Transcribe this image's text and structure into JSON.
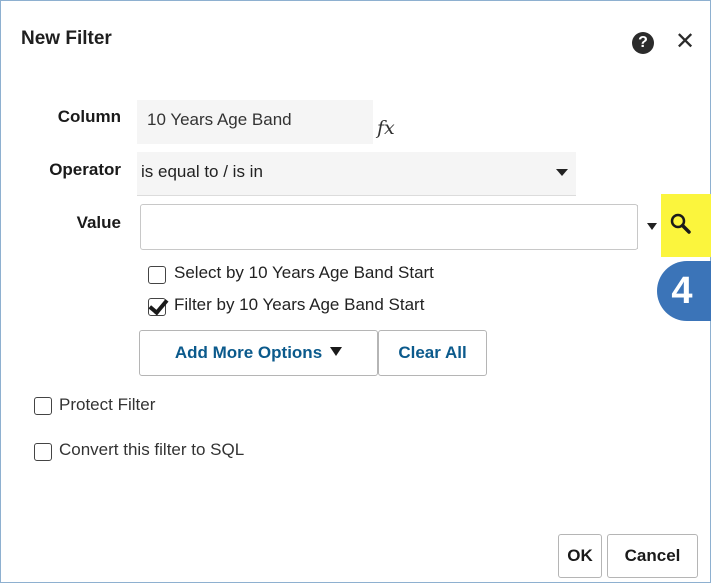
{
  "dialog": {
    "title": "New Filter",
    "help_icon_text": "?",
    "close_icon_text": "✕"
  },
  "form": {
    "column_label": "Column",
    "column_value": "10 Years Age Band",
    "fx_icon_text": "fx",
    "operator_label": "Operator",
    "operator_value": "is equal to / is in",
    "value_label": "Value",
    "value_input": ""
  },
  "options": {
    "select_by_label": "Select by 10 Years Age Band Start",
    "select_by_checked": false,
    "filter_by_label": "Filter by 10 Years Age Band Start",
    "filter_by_checked": true,
    "add_more_label": "Add More Options",
    "clear_all_label": "Clear All"
  },
  "extra": {
    "protect_filter_label": "Protect Filter",
    "protect_filter_checked": false,
    "convert_sql_label": "Convert this filter to SQL",
    "convert_sql_checked": false
  },
  "annotation": {
    "step_number": "4",
    "highlight_color": "#fbf53d",
    "badge_color": "#3b74b8"
  },
  "footer": {
    "ok_label": "OK",
    "cancel_label": "Cancel"
  }
}
